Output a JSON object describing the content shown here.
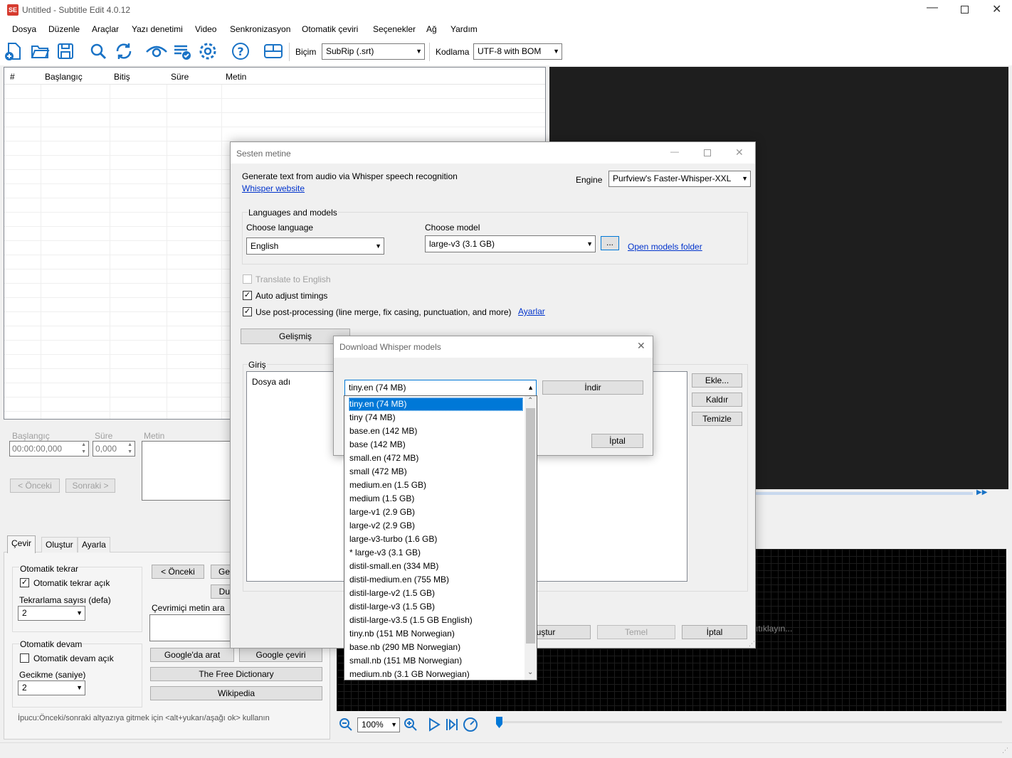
{
  "window": {
    "title": "Untitled - Subtitle Edit 4.0.12",
    "logo": "SE"
  },
  "menu": [
    "Dosya",
    "Düzenle",
    "Araçlar",
    "Yazı denetimi",
    "Video",
    "Senkronizasyon",
    "Otomatik çeviri",
    "Seçenekler",
    "Ağ",
    "Yardım"
  ],
  "toolbar": {
    "format_label": "Biçim",
    "format_value": "SubRip (.srt)",
    "encoding_label": "Kodlama",
    "encoding_value": "UTF-8 with BOM",
    "icons": [
      "new-file-icon",
      "open-folder-icon",
      "save-icon",
      "search-icon",
      "replace-icon",
      "visual-sync-icon",
      "spell-check-icon",
      "settings-icon",
      "help-icon",
      "layout-icon"
    ]
  },
  "subtitle_grid": {
    "headers": [
      "#",
      "Başlangıç",
      "Bitiş",
      "Süre",
      "Metin"
    ]
  },
  "edit_panel": {
    "start_label": "Başlangıç",
    "start_value": "00:00:00,000",
    "duration_label": "Süre",
    "duration_value": "0,000",
    "text_label": "Metin",
    "prev": "< Önceki",
    "next": "Sonraki >"
  },
  "bottom_tabs": [
    "Çevir",
    "Oluştur",
    "Ayarla"
  ],
  "translate_panel": {
    "auto_repeat_title": "Otomatik tekrar",
    "auto_repeat_on": "Otomatik tekrar açık",
    "repeat_count_label": "Tekrarlama sayısı (defa)",
    "repeat_count_value": "2",
    "auto_continue_title": "Otomatik devam",
    "auto_continue_on": "Otomatik devam açık",
    "delay_label": "Gecikme (saniye)",
    "delay_value": "2",
    "prev_btn": "< Önceki",
    "ge_btn": "Ge",
    "du_btn": "Du",
    "search_online_label": "Çevrimiçi metin ara",
    "google_search": "Google'da arat",
    "google_translate": "Google çeviri",
    "free_dictionary": "The Free Dictionary",
    "wikipedia": "Wikipedia",
    "tip": "İpucu:Önceki/sonraki altyazıya gitmek için <alt+yukarı/aşağı ok> kullanın"
  },
  "video_controls": {
    "zoom": "100%",
    "waveform_hint": "ıtıklayın..."
  },
  "dialog_stt": {
    "title": "Sesten metine",
    "desc": "Generate text from audio via Whisper speech recognition",
    "website_link": "Whisper website",
    "engine_label": "Engine",
    "engine_value": "Purfview's Faster-Whisper-XXL",
    "group_title": "Languages and models",
    "lang_label": "Choose language",
    "lang_value": "English",
    "model_label": "Choose model",
    "model_value": "large-v3 (3.1 GB)",
    "browse_btn": "...",
    "open_models": "Open models folder",
    "translate_cb": "Translate to English",
    "auto_adjust_cb": "Auto adjust timings",
    "post_proc_cb": "Use post-processing (line merge, fix casing, punctuation, and more)",
    "settings_link": "Ayarlar",
    "advanced_btn": "Gelişmiş",
    "input_label": "Giriş",
    "file_col": "Dosya adı",
    "add_btn": "Ekle...",
    "remove_btn": "Kaldır",
    "clear_btn": "Temizle",
    "generate_btn": "luştur",
    "basic_btn": "Temel",
    "cancel_btn": "İptal"
  },
  "dialog_download": {
    "title": "Download Whisper models",
    "selected": "tiny.en (74 MB)",
    "download_btn": "İndir",
    "cancel_btn": "İptal",
    "options": [
      "tiny.en (74 MB)",
      "tiny (74 MB)",
      "base.en (142 MB)",
      "base (142 MB)",
      "small.en (472 MB)",
      "small (472 MB)",
      "medium.en (1.5 GB)",
      "medium (1.5 GB)",
      "large-v1 (2.9 GB)",
      "large-v2 (2.9 GB)",
      "large-v3-turbo (1.6 GB)",
      "* large-v3 (3.1 GB)",
      "distil-small.en (334 MB)",
      "distil-medium.en (755 MB)",
      "distil-large-v2 (1.5 GB)",
      "distil-large-v3 (1.5 GB)",
      "distil-large-v3.5 (1.5 GB English)",
      "tiny.nb (151 MB Norwegian)",
      "base.nb (290 MB Norwegian)",
      "small.nb (151 MB Norwegian)",
      "medium.nb (3.1 GB Norwegian)"
    ]
  },
  "colors": {
    "accent": "#0078d7",
    "link": "#0033cc",
    "icon_blue": "#1a73c6",
    "video_bg": "#1e1e1e"
  }
}
